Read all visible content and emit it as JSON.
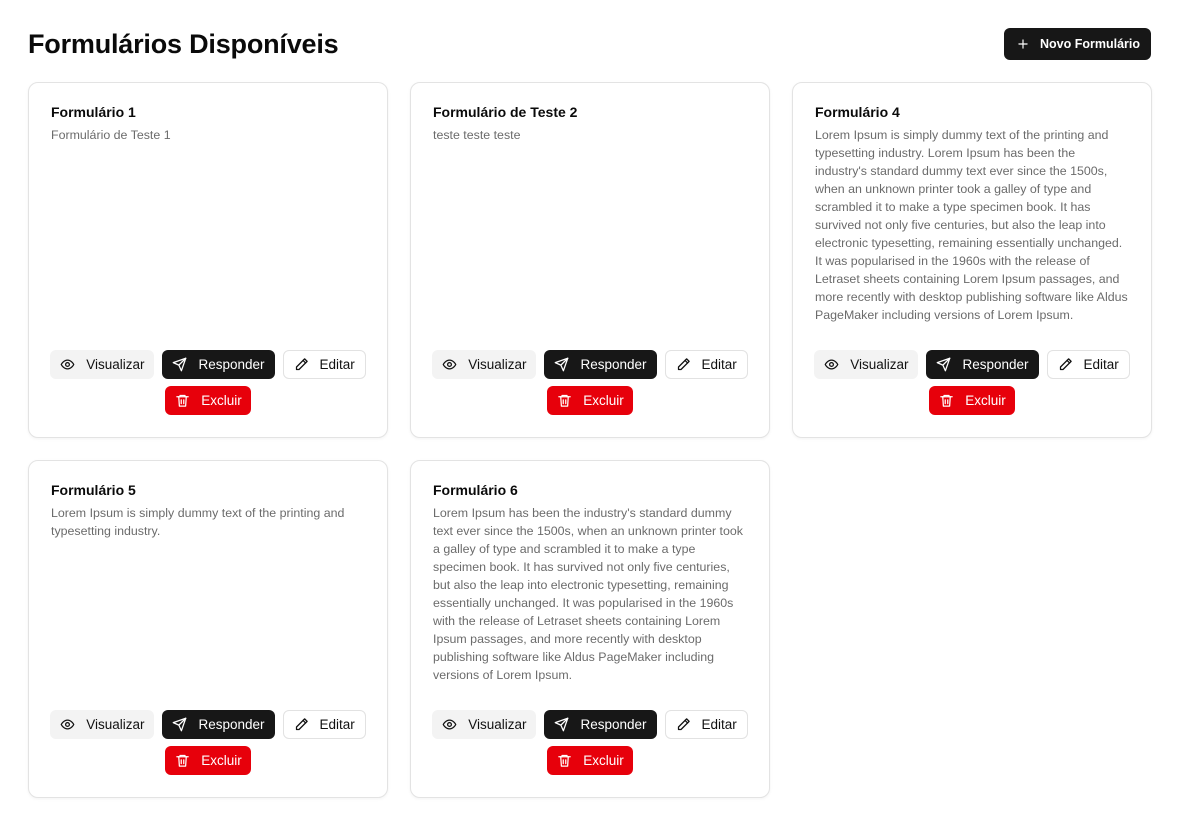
{
  "header": {
    "title": "Formulários Disponíveis",
    "new_button_label": "Novo Formulário",
    "new_button_icon": "plus-icon"
  },
  "actions": {
    "view_label": "Visualizar",
    "view_icon": "eye-icon",
    "reply_label": "Responder",
    "reply_icon": "send-icon",
    "edit_label": "Editar",
    "edit_icon": "pencil-icon",
    "delete_label": "Excluir",
    "delete_icon": "trash-icon"
  },
  "colors": {
    "primary": "#171717",
    "danger": "#e7000b",
    "muted_text": "#6b6b6b"
  },
  "forms": [
    {
      "title": "Formulário 1",
      "description": "Formulário de Teste 1"
    },
    {
      "title": "Formulário de Teste 2",
      "description": "teste teste teste"
    },
    {
      "title": "Formulário 4",
      "description": "Lorem Ipsum is simply dummy text of the printing and typesetting industry. Lorem Ipsum has been the industry's standard dummy text ever since the 1500s, when an unknown printer took a galley of type and scrambled it to make a type specimen book. It has survived not only five centuries, but also the leap into electronic typesetting, remaining essentially unchanged. It was popularised in the 1960s with the release of Letraset sheets containing Lorem Ipsum passages, and more recently with desktop publishing software like Aldus PageMaker including versions of Lorem Ipsum."
    },
    {
      "title": "Formulário 5",
      "description": "Lorem Ipsum is simply dummy text of the printing and typesetting industry."
    },
    {
      "title": "Formulário 6",
      "description": "Lorem Ipsum has been the industry's standard dummy text ever since the 1500s, when an unknown printer took a galley of type and scrambled it to make a type specimen book. It has survived not only five centuries, but also the leap into electronic typesetting, remaining essentially unchanged. It was popularised in the 1960s with the release of Letraset sheets containing Lorem Ipsum passages, and more recently with desktop publishing software like Aldus PageMaker including versions of Lorem Ipsum."
    }
  ]
}
